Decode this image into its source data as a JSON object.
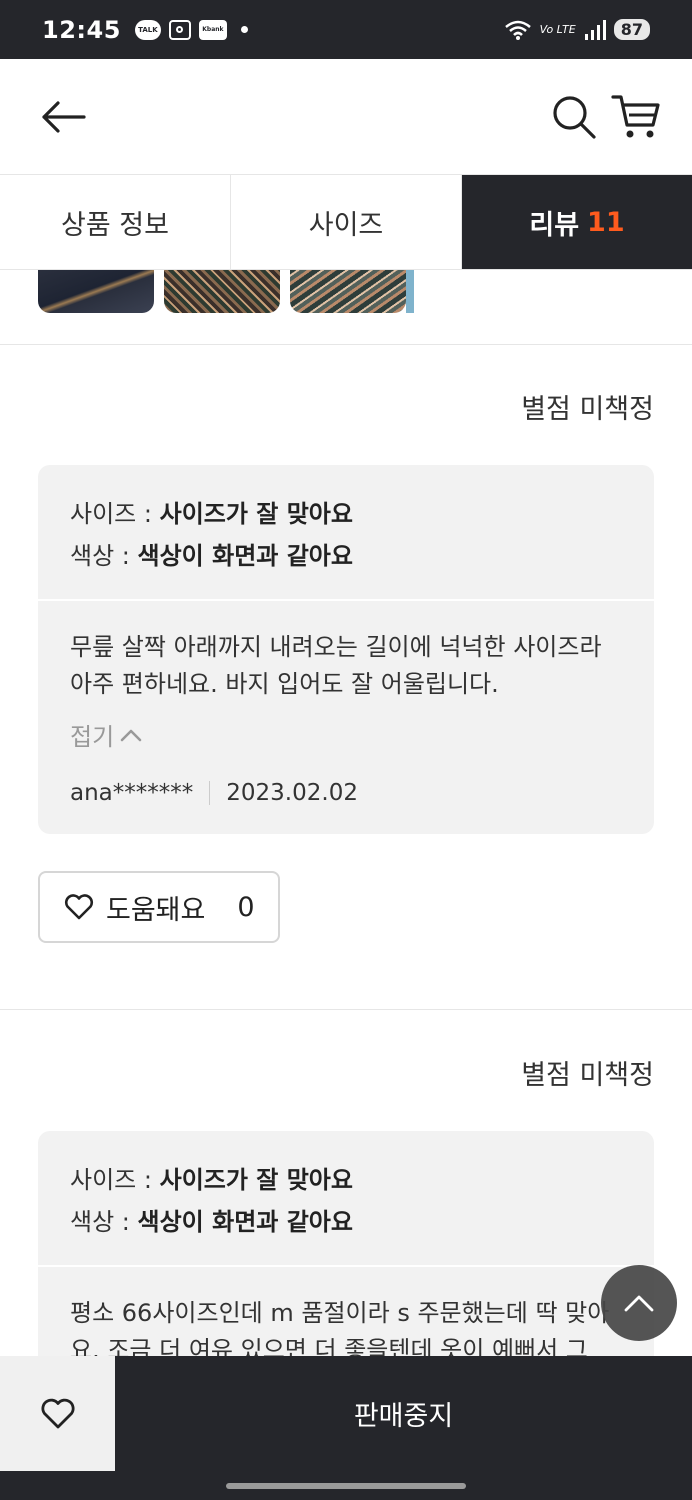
{
  "status_bar": {
    "time": "12:45",
    "talk_icon_text": "TALK",
    "kbank_icon_text": "Kbank",
    "network": "Vo LTE",
    "battery": "87"
  },
  "tabs": [
    {
      "label": "상품 정보",
      "active": false
    },
    {
      "label": "사이즈",
      "active": false
    },
    {
      "label": "리뷰",
      "count": "11",
      "active": true
    }
  ],
  "reviews": [
    {
      "rating_text": "별점 미책정",
      "size_key": "사이즈 :",
      "size_value": "사이즈가 잘 맞아요",
      "color_key": "색상 :",
      "color_value": "색상이 화면과 같아요",
      "text_line1": "무릎 살짝 아래까지 내려오는 길이에 넉넉한 사이즈라",
      "text_line2": "아주 편하네요. 바지 입어도 잘 어울립니다.",
      "fold_label": "접기",
      "author": "ana*******",
      "date": "2023.02.02",
      "helpful_label": "도움돼요",
      "helpful_count": "0"
    },
    {
      "rating_text": "별점 미책정",
      "size_key": "사이즈 :",
      "size_value": "사이즈가 잘 맞아요",
      "color_key": "색상 :",
      "color_value": "색상이 화면과 같아요",
      "text_line1": "평소 66사이즈인데 m 품절이라 s 주문했는데 딱 맞아",
      "text_line2": "요. 조금 더 여유 있으면 더 좋을텐데 옷이 예뻐서 그"
    }
  ],
  "bottom_bar": {
    "action_label": "판매중지"
  },
  "colors": {
    "dark": "#25262b",
    "accent": "#ff5b1e",
    "card_bg": "#f2f2f2"
  }
}
